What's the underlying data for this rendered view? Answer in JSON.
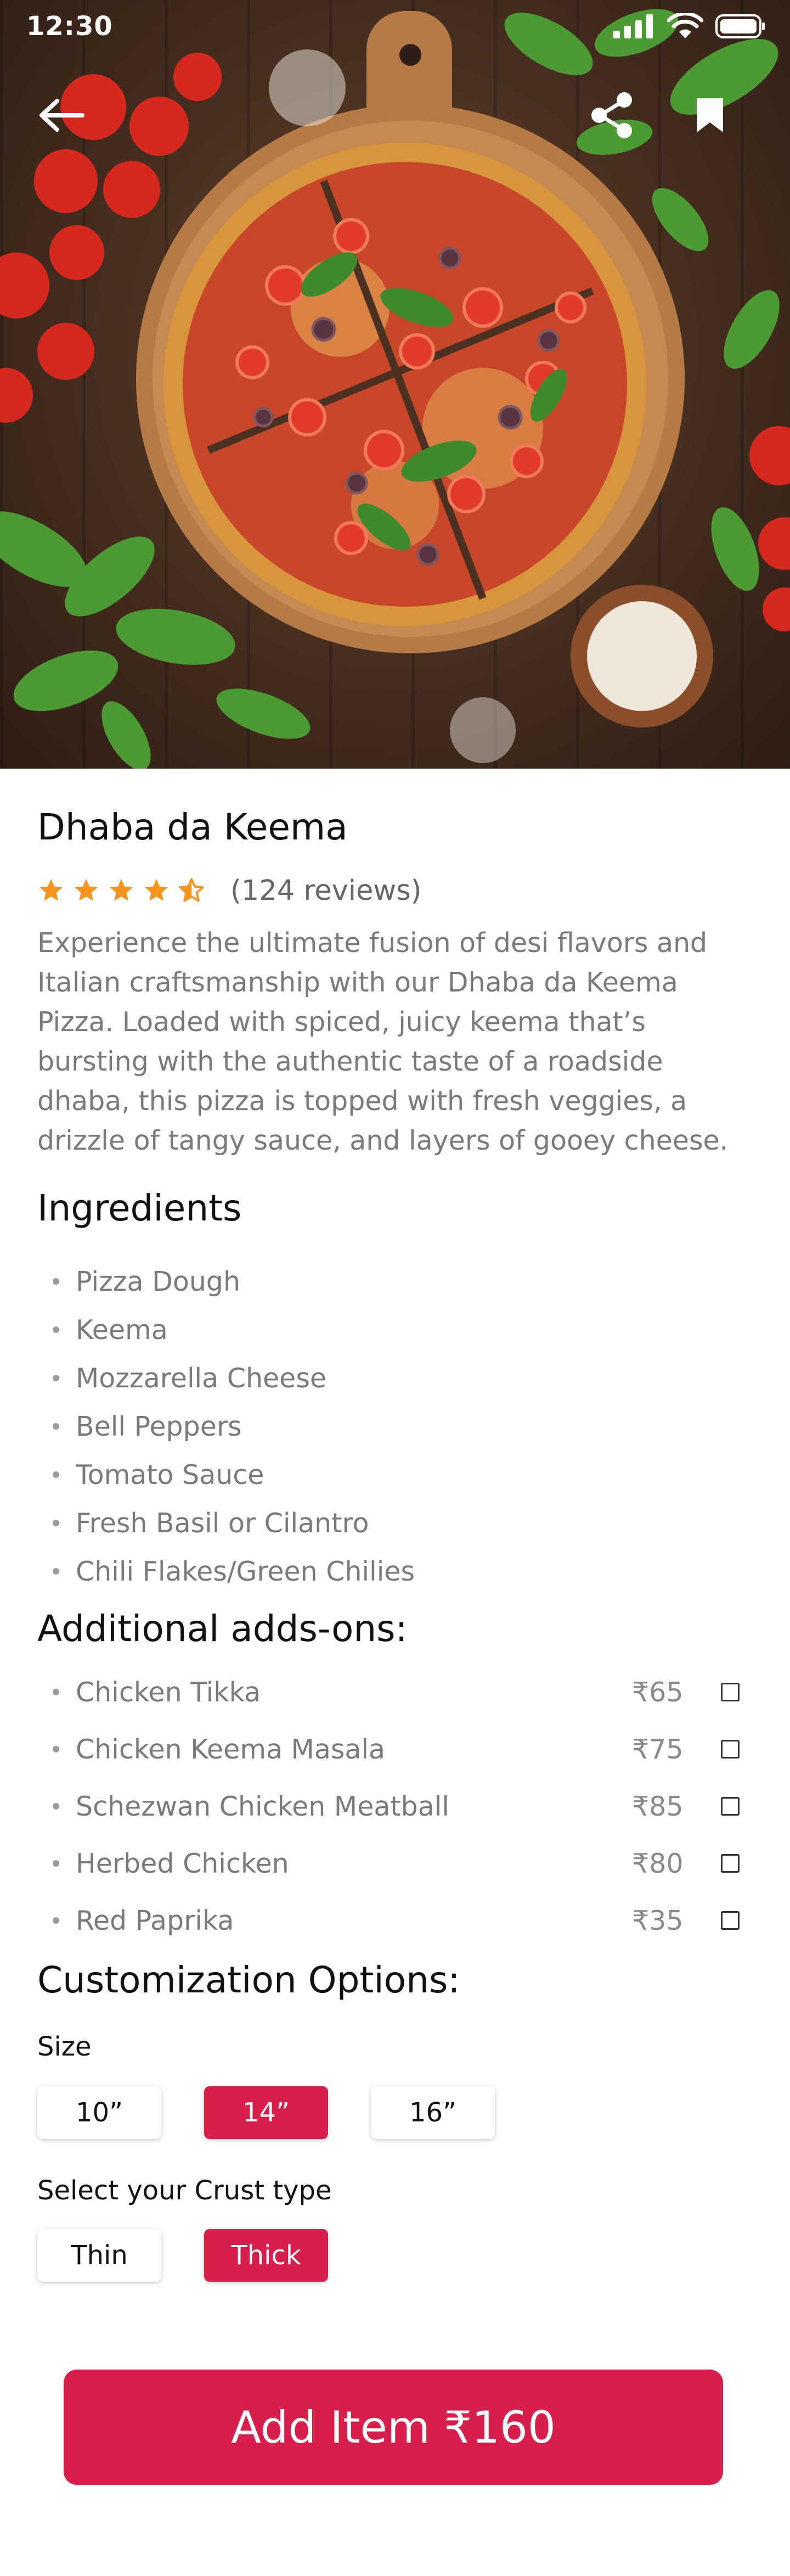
{
  "status_bar": {
    "time": "12:30"
  },
  "product": {
    "name": "Dhaba da Keema",
    "rating": 4.5,
    "reviews_text": "(124 reviews)",
    "description": "Experience the ultimate fusion of desi flavors and Italian craftsmanship with our Dhaba da Keema Pizza. Loaded with spiced, juicy keema that’s bursting with the authentic taste of a roadside dhaba, this pizza is topped with fresh veggies, a drizzle of tangy sauce, and layers of gooey cheese."
  },
  "ingredients": {
    "title": "Ingredients",
    "items": [
      "Pizza Dough",
      "Keema",
      "Mozzarella Cheese",
      "Bell Peppers",
      "Tomato Sauce",
      "Fresh Basil or Cilantro",
      "Chili Flakes/Green Chilies"
    ]
  },
  "addons": {
    "title": "Additional adds-ons:",
    "items": [
      {
        "name": "Chicken Tikka",
        "price": "₹65",
        "checked": false
      },
      {
        "name": "Chicken Keema Masala",
        "price": "₹75",
        "checked": false
      },
      {
        "name": "Schezwan Chicken Meatball",
        "price": "₹85",
        "checked": false
      },
      {
        "name": "Herbed Chicken",
        "price": "₹80",
        "checked": false
      },
      {
        "name": "Red Paprika",
        "price": "₹35",
        "checked": false
      }
    ]
  },
  "customization": {
    "title": "Customization Options:",
    "size_label": "Size",
    "sizes": [
      "10”",
      "14”",
      "16”"
    ],
    "selected_size": "14”",
    "crust_label": "Select your Crust type",
    "crusts": [
      "Thin",
      "Thick"
    ],
    "selected_crust": "Thick"
  },
  "cta": {
    "label": "Add Item ₹160"
  },
  "colors": {
    "accent": "#d81e4a",
    "star": "#f7941d"
  }
}
